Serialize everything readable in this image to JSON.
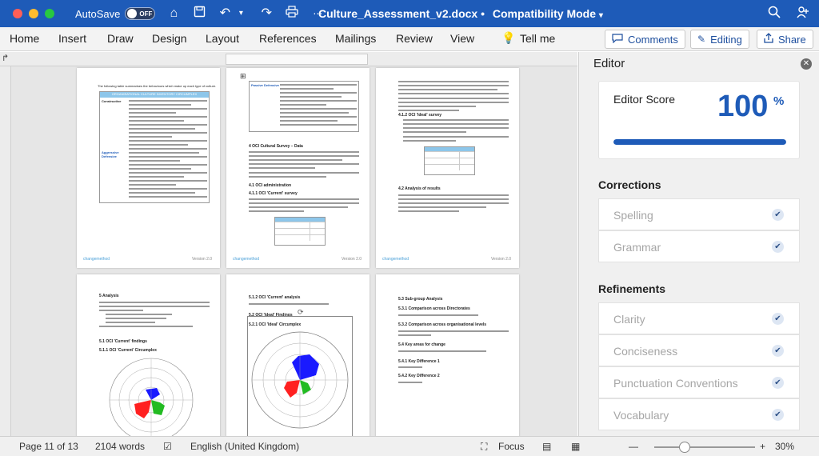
{
  "titlebar": {
    "autosave_label": "AutoSave",
    "autosave_state": "OFF",
    "document_name": "Culture_Assessment_v2.docx",
    "separator": "•",
    "mode": "Compatibility Mode",
    "icons": [
      "home-icon",
      "save-icon",
      "undo-icon",
      "redo-icon",
      "print-icon",
      "customize-icon",
      "search-icon",
      "share-person-icon"
    ]
  },
  "ribbon": {
    "tabs": [
      "Home",
      "Insert",
      "Draw",
      "Design",
      "Layout",
      "References",
      "Mailings",
      "Review",
      "View"
    ],
    "tell_me": "Tell me",
    "comments": "Comments",
    "editing": "Editing",
    "share": "Share"
  },
  "pages": {
    "p1": {
      "intro": "The following table summarises the behaviours which make up each type of culture.",
      "table_title": "ORGANISATIONAL CULTURE INVENTORY CIRCUMPLEX",
      "row_labels": [
        "Constructive",
        "Aggressive Defensive"
      ]
    },
    "p2": {
      "table_cell": "Passive Defensive",
      "heading": "4     OCI Cultural Survey – Data",
      "sub1": "4.1     OCI administration",
      "sub2": "4.1.1   OCI 'Current' survey"
    },
    "p3": {
      "sub1": "4.1.2 OCI 'Ideal' survey",
      "sub2": "4.2     Analysis of results"
    },
    "p4": {
      "heading": "5     Analysis",
      "sub1": "5.1     OCI 'Current' findings",
      "sub2": "5.1.1   OCI 'Current' Circumplex"
    },
    "p5": {
      "sub1": "5.1.2   OCI 'Current' analysis",
      "sub2": "5.2     OCI 'Ideal' Findings",
      "sub3": "5.2.1   OCI 'Ideal' Circumplex"
    },
    "p6": {
      "heading": "5.3     Sub-group Analysis",
      "sub1": "5.3.1   Comparison across Directorates",
      "sub2": "5.3.2   Comparison across organisational levels",
      "sub3": "5.4     Key areas for change",
      "sub4": "5.4.1   Key Difference 1",
      "sub5": "5.4.2   Key Difference 2"
    },
    "footer_logo": "changemethod",
    "footer_version": "Version 2.0"
  },
  "editor": {
    "title": "Editor",
    "score_label": "Editor Score",
    "score_value": "100",
    "score_unit": "%",
    "score_fraction": 1.0,
    "corrections_title": "Corrections",
    "corrections": [
      "Spelling",
      "Grammar"
    ],
    "refinements_title": "Refinements",
    "refinements": [
      "Clarity",
      "Conciseness",
      "Punctuation Conventions",
      "Vocabulary"
    ]
  },
  "statusbar": {
    "page_info": "Page 11 of 13",
    "word_count": "2104 words",
    "language": "English (United Kingdom)",
    "focus": "Focus",
    "zoom": "30%",
    "zoom_fraction": 0.3
  },
  "colors": {
    "titlebar": "#1e5bb8",
    "accent": "#1e5bb8",
    "radar_blue": "#1a1aff",
    "radar_red": "#ff2020",
    "radar_green": "#22bb22"
  }
}
